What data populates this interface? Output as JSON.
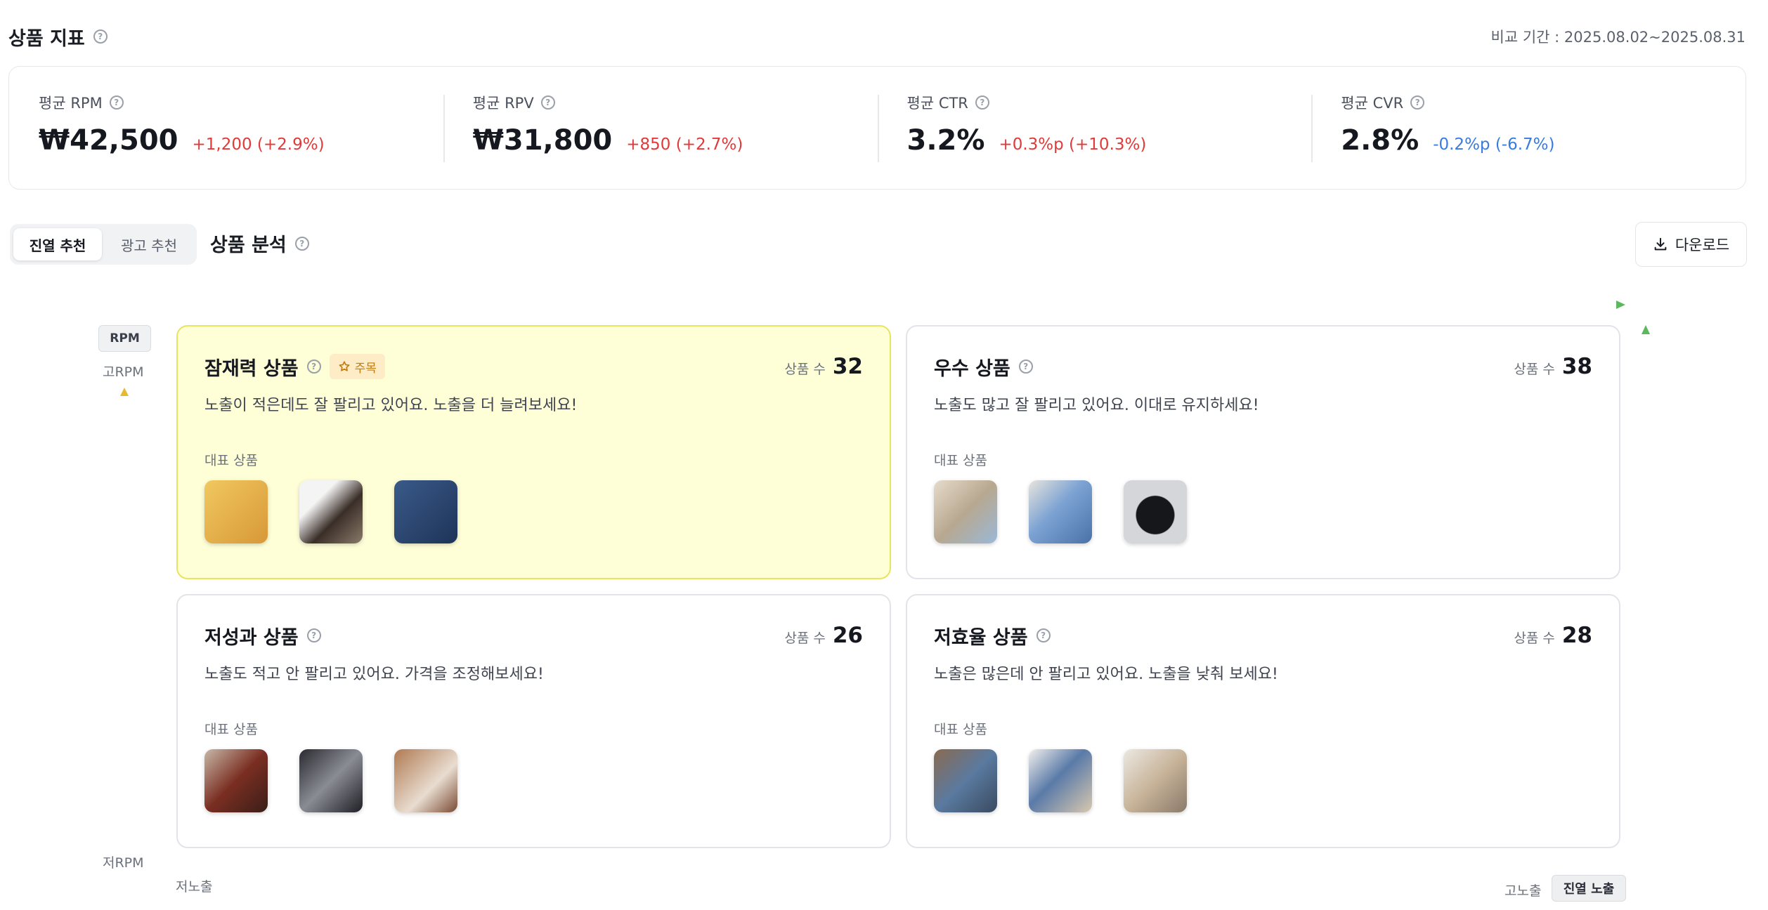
{
  "header": {
    "title": "상품 지표",
    "period": "비교 기간 : 2025.08.02~2025.08.31"
  },
  "metrics": [
    {
      "label": "평균 RPM",
      "value": "₩42,500",
      "delta": "+1,200 (+2.9%)",
      "trend": "up"
    },
    {
      "label": "평균 RPV",
      "value": "₩31,800",
      "delta": "+850 (+2.7%)",
      "trend": "up"
    },
    {
      "label": "평균 CTR",
      "value": "3.2%",
      "delta": "+0.3%p (+10.3%)",
      "trend": "up"
    },
    {
      "label": "평균 CVR",
      "value": "2.8%",
      "delta": "-0.2%p (-6.7%)",
      "trend": "down"
    }
  ],
  "toolbar": {
    "tabs": [
      {
        "label": "진열 추천",
        "active": true
      },
      {
        "label": "광고 추천",
        "active": false
      }
    ],
    "section_title": "상품 분석",
    "download_label": "다운로드"
  },
  "axes": {
    "y_badge": "RPM",
    "y_high": "고RPM",
    "y_low": "저RPM",
    "x_low": "저노출",
    "x_high": "고노출",
    "x_badge": "진열 노출"
  },
  "quadrants": [
    {
      "title": "잠재력 상품",
      "badge": "주목",
      "count_label": "상품 수",
      "count": "32",
      "description": "노출이 적은데도 잘 팔리고 있어요. 노출을 더 늘려보세요!",
      "rep_label": "대표 상품",
      "thumbs": [
        "#e8b84a",
        "#8a7a6a",
        "#2e4a7a"
      ]
    },
    {
      "title": "우수 상품",
      "badge": "",
      "count_label": "상품 수",
      "count": "38",
      "description": "노출도 많고 잘 팔리고 있어요. 이대로 유지하세요!",
      "rep_label": "대표 상품",
      "thumbs": [
        "#cfc3b0",
        "#7b9fcf",
        "#1e1f24"
      ]
    },
    {
      "title": "저성과 상품",
      "badge": "",
      "count_label": "상품 수",
      "count": "26",
      "description": "노출도 적고 안 팔리고 있어요. 가격을 조정해보세요!",
      "rep_label": "대표 상품",
      "thumbs": [
        "#7a3a2a",
        "#3a3a42",
        "#9a6a4a"
      ]
    },
    {
      "title": "저효율 상품",
      "badge": "",
      "count_label": "상품 수",
      "count": "28",
      "description": "노출은 많은데 안 팔리고 있어요. 노출을 낮춰 보세요!",
      "rep_label": "대표 상품",
      "thumbs": [
        "#5a7090",
        "#b8c8d8",
        "#d8cfc4"
      ]
    }
  ]
}
